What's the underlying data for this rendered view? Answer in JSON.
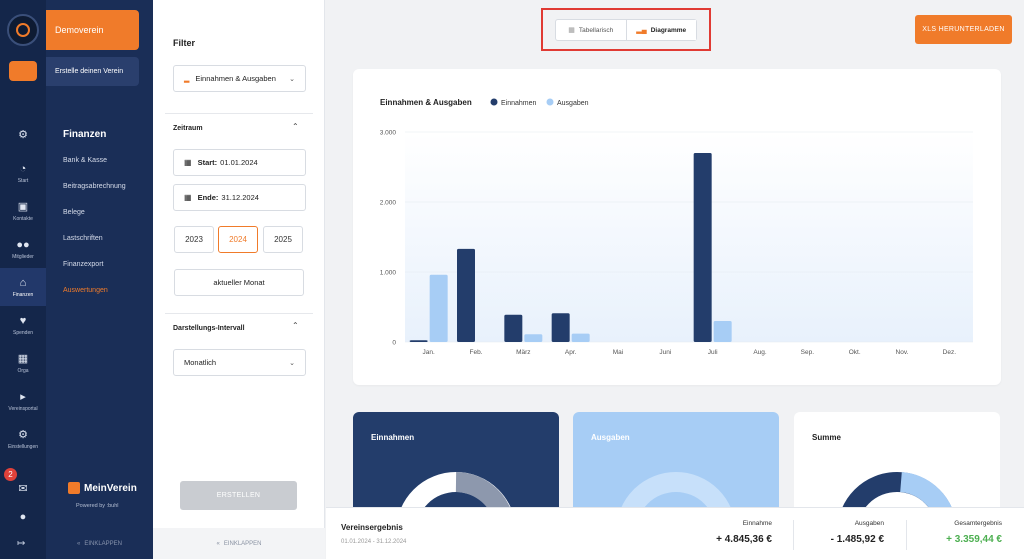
{
  "app": {
    "club_name": "Demoverein",
    "create_club": "Erstelle deinen Verein"
  },
  "rail": [
    {
      "name": "notifications",
      "label": "",
      "icon": "bell-icon"
    },
    {
      "name": "start",
      "label": "Start",
      "icon": "gauge-icon"
    },
    {
      "name": "kontakte",
      "label": "Kontakte",
      "icon": "contacts-icon"
    },
    {
      "name": "mitglieder",
      "label": "Mitglieder",
      "icon": "group-icon"
    },
    {
      "name": "finanzen",
      "label": "Finanzen",
      "icon": "bank-icon"
    },
    {
      "name": "spenden",
      "label": "Spenden",
      "icon": "donate-icon"
    },
    {
      "name": "orga",
      "label": "Orga",
      "icon": "calendar-icon"
    },
    {
      "name": "vereinsportal",
      "label": "Vereinsportal",
      "icon": "megaphone-icon"
    },
    {
      "name": "einstellungen",
      "label": "Einstellungen",
      "icon": "gear-icon"
    }
  ],
  "rail_badge": "2",
  "subnav": {
    "section_title": "Finanzen",
    "items": [
      "Bank & Kasse",
      "Beitragsabrechnung",
      "Belege",
      "Lastschriften",
      "Finanzexport",
      "Auswertungen"
    ],
    "active": "Auswertungen",
    "brand": "MeinVerein",
    "powered_by": "Powered by :buhl",
    "collapse": "EINKLAPPEN"
  },
  "filter": {
    "title": "Filter",
    "type_select": "Einnahmen & Ausgaben",
    "zeitraum_label": "Zeitraum",
    "start_label": "Start:",
    "start_value": "01.01.2024",
    "end_label": "Ende:",
    "end_value": "31.12.2024",
    "years": [
      "2023",
      "2024",
      "2025"
    ],
    "selected_year": "2024",
    "current_month": "aktueller Monat",
    "interval_label": "Darstellungs-Intervall",
    "interval_value": "Monatlich",
    "create_button": "ERSTELLEN",
    "collapse": "EINKLAPPEN"
  },
  "view_toggle": {
    "table_label": "Tabellarisch",
    "chart_label": "Diagramme",
    "active": "Diagramme"
  },
  "download_button": "XLS HERUNTERLADEN",
  "chart_data": {
    "type": "bar",
    "title": "Einnahmen & Ausgaben",
    "categories": [
      "Jan.",
      "Feb.",
      "März",
      "Apr.",
      "Mai",
      "Juni",
      "Juli",
      "Aug.",
      "Sep.",
      "Okt.",
      "Nov.",
      "Dez."
    ],
    "series": [
      {
        "name": "Einnahmen",
        "color": "#233d6b",
        "values": [
          25,
          1330,
          390,
          410,
          0,
          0,
          2700,
          0,
          0,
          0,
          0,
          0
        ]
      },
      {
        "name": "Ausgaben",
        "color": "#a7cdf5",
        "values": [
          960,
          0,
          110,
          120,
          0,
          0,
          300,
          0,
          0,
          0,
          0,
          0
        ]
      }
    ],
    "yticks": [
      "0",
      "1.000",
      "2.000",
      "3.000"
    ],
    "ylim": [
      0,
      3000
    ],
    "legend_position": "top"
  },
  "cards": {
    "einnahmen": "Einnahmen",
    "ausgaben": "Ausgaben",
    "summe": "Summe"
  },
  "result": {
    "title": "Vereinsergebnis",
    "period": "01.01.2024 - 31.12.2024",
    "income_label": "Einnahme",
    "income_value": "+ 4.845,36 €",
    "expense_label": "Ausgaben",
    "expense_value": "- 1.485,92 €",
    "total_label": "Gesamtergebnis",
    "total_value": "+ 3.359,44 €"
  }
}
